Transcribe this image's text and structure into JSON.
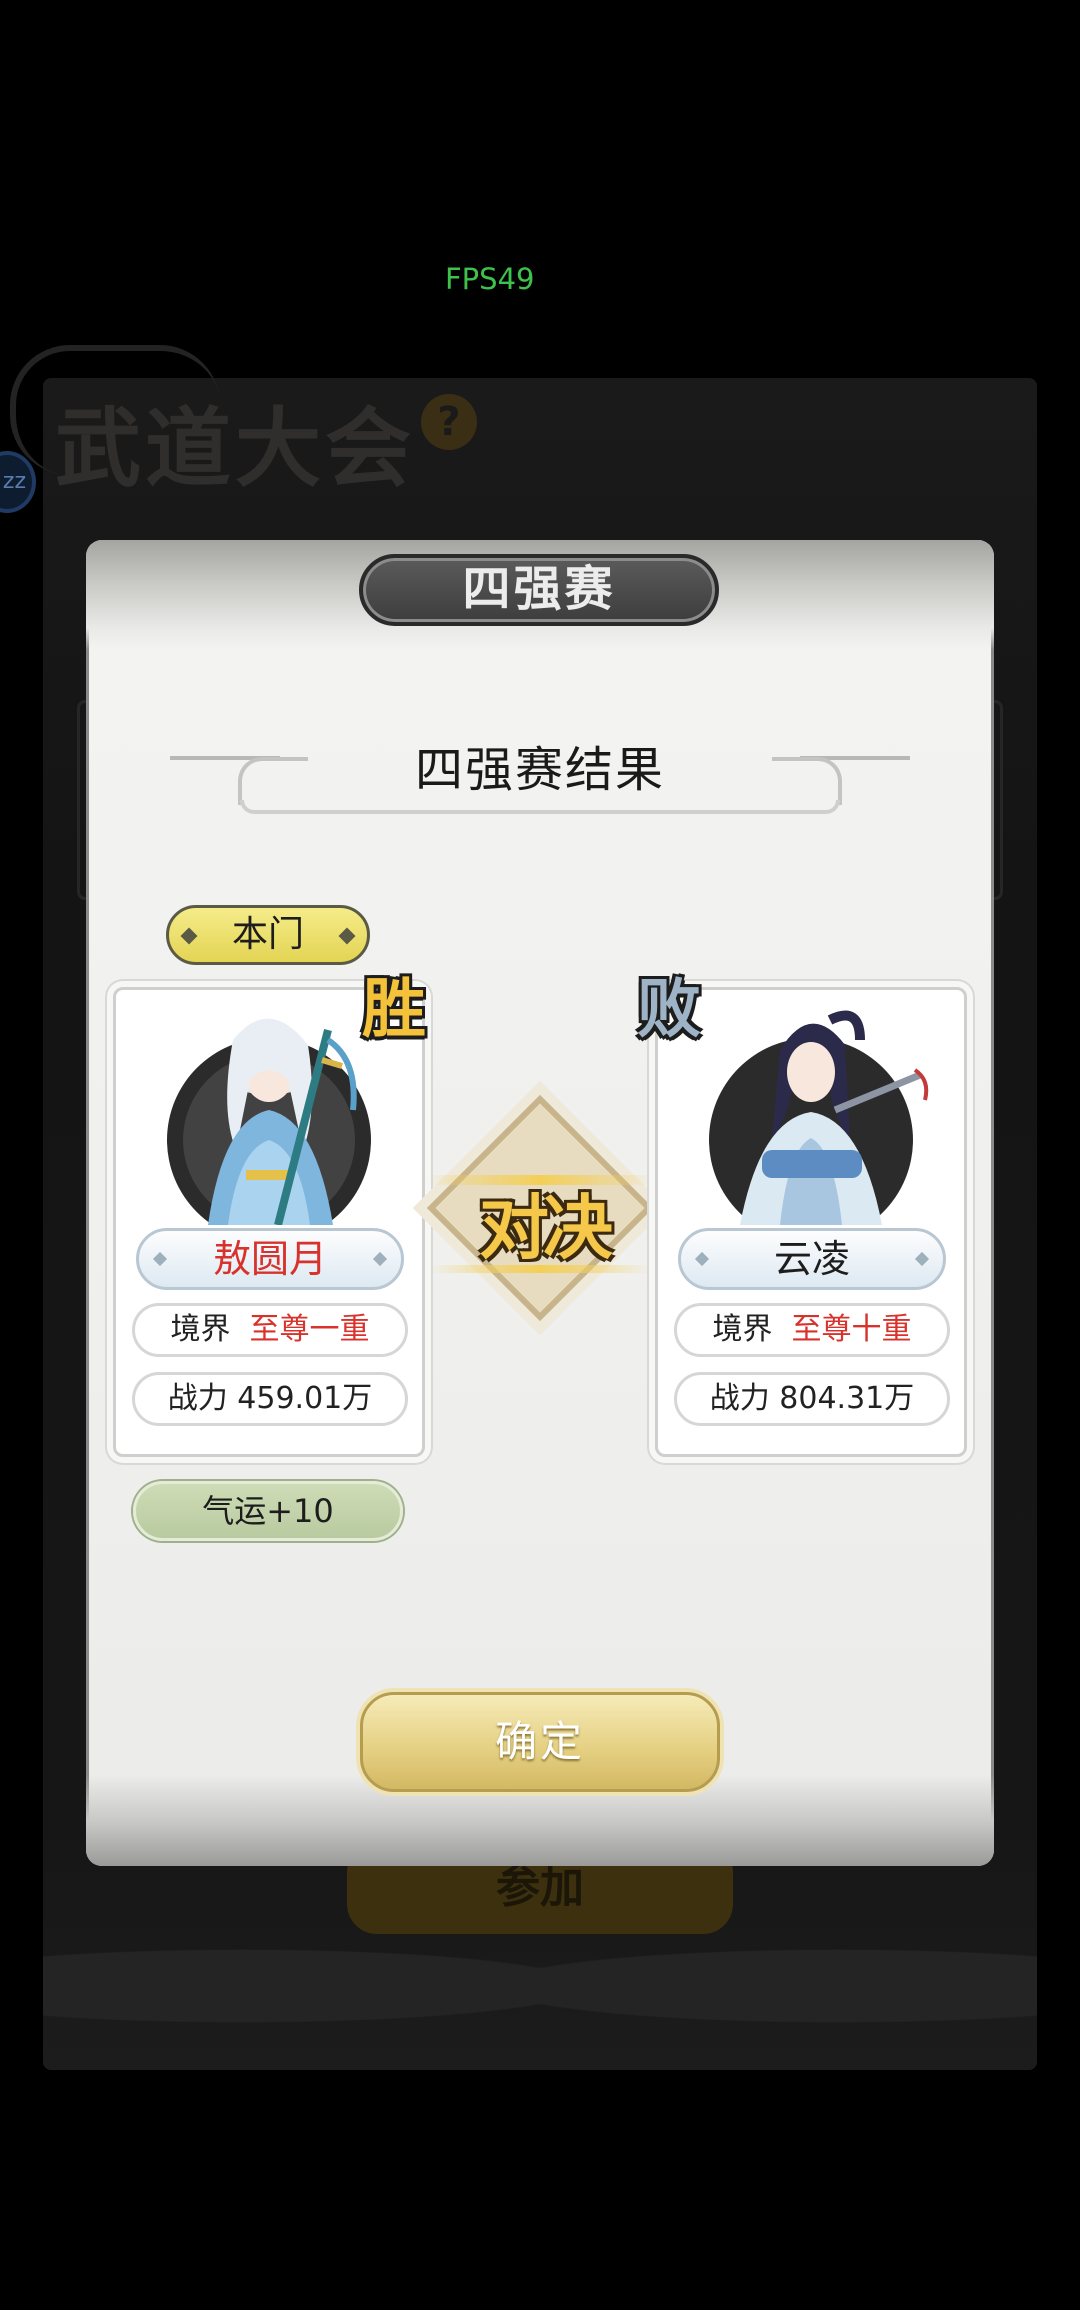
{
  "overlay": {
    "fps": "FPS49"
  },
  "background": {
    "title": "武道大会",
    "help_icon": "?",
    "avatar_text": "zz",
    "join_button": "参加"
  },
  "modal": {
    "header": "四强赛",
    "result_title": "四强赛结果",
    "left_tag": "本门",
    "versus": "对决",
    "confirm_button": "确定",
    "reward": "气运+10"
  },
  "fighters": [
    {
      "result": "胜",
      "name": "敖圆月",
      "realm_label": "境界",
      "realm_value": "至尊一重",
      "power_label": "战力",
      "power_value": "459.01万"
    },
    {
      "result": "败",
      "name": "云凌",
      "realm_label": "境界",
      "realm_value": "至尊十重",
      "power_label": "战力",
      "power_value": "804.31万"
    }
  ],
  "colors": {
    "winner_name": "#d8322c",
    "realm_value": "#d8322c",
    "loser_name": "#1d1d1d",
    "fps": "#3ec24c"
  }
}
